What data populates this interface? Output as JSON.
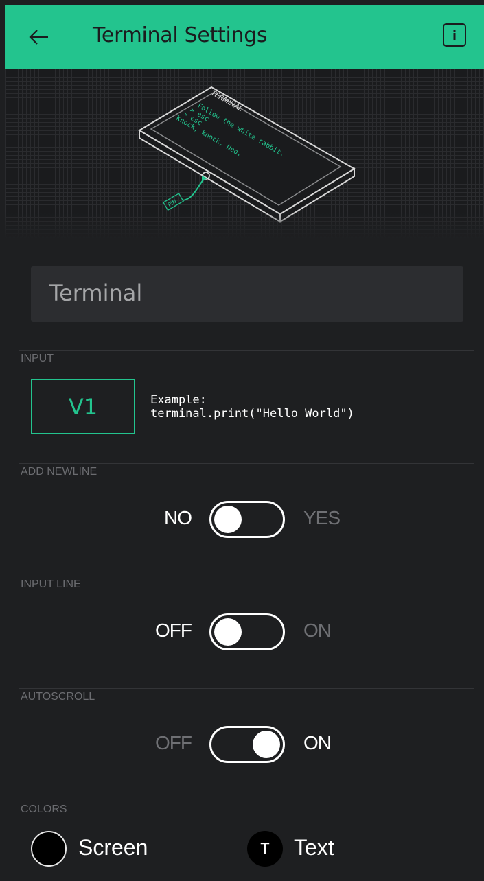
{
  "header": {
    "title": "Terminal Settings",
    "back_icon": "arrow-left-icon",
    "info_icon": "info-icon",
    "bg_color": "#23c48e"
  },
  "hero": {
    "device_title": "TERMINAL",
    "lines": [
      "Follow the white rabbit.",
      "> esc",
      "> esc",
      "Knock, knock, Neo."
    ],
    "pin_label": "PIN"
  },
  "name_field": {
    "value": "Terminal"
  },
  "input_section": {
    "label": "INPUT",
    "pin_value": "V1",
    "example_label": "Example:",
    "example_code": "terminal.print(\"Hello World\")"
  },
  "add_newline": {
    "label": "ADD NEWLINE",
    "off_label": "NO",
    "on_label": "YES",
    "state": "off"
  },
  "input_line": {
    "label": "INPUT LINE",
    "off_label": "OFF",
    "on_label": "ON",
    "state": "off"
  },
  "autoscroll": {
    "label": "AUTOSCROLL",
    "off_label": "OFF",
    "on_label": "ON",
    "state": "on"
  },
  "colors": {
    "label": "COLORS",
    "screen_label": "Screen",
    "screen_color": "#000000",
    "text_label": "Text",
    "text_swatch_letter": "T",
    "text_color": "#ffffff"
  }
}
